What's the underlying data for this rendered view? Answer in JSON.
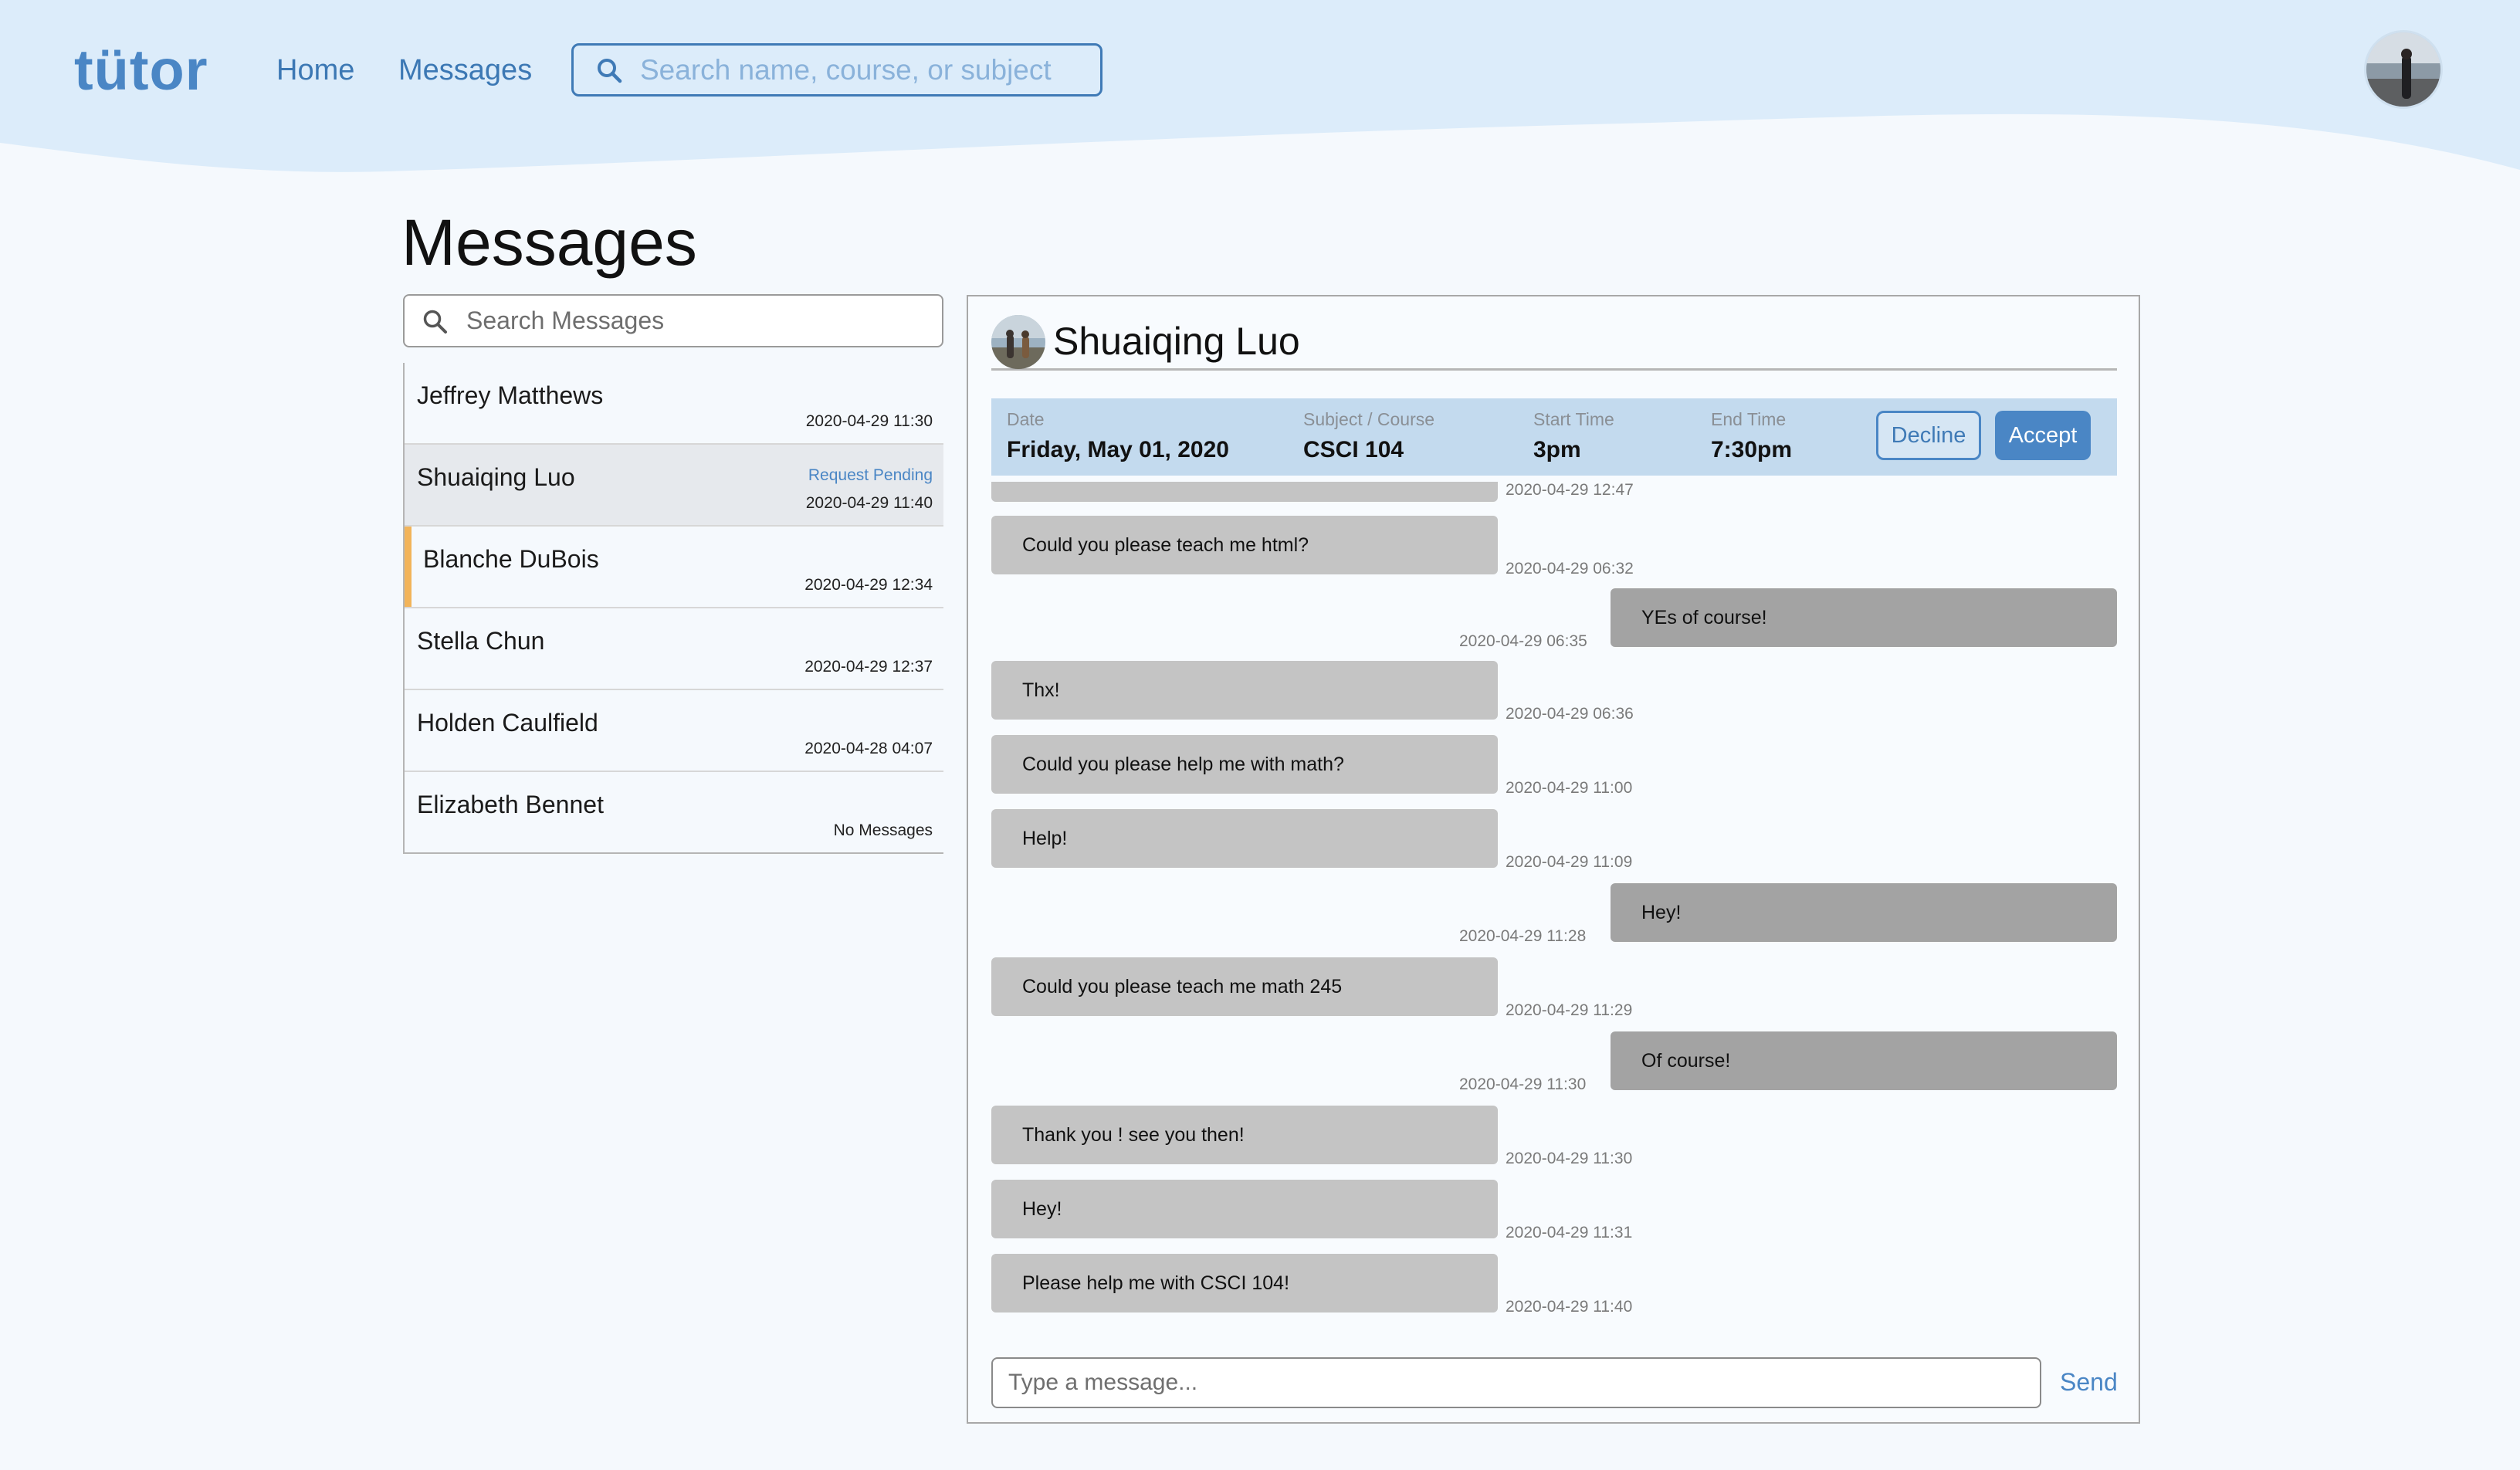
{
  "brand": {
    "logo_text": "tütor",
    "primary_color": "#4a86c5",
    "header_bg": "#dcecfa"
  },
  "nav": {
    "home": "Home",
    "messages": "Messages"
  },
  "global_search": {
    "placeholder": "Search name, course, or subject",
    "icon": "search-icon"
  },
  "page_title": "Messages",
  "message_search": {
    "placeholder": "Search Messages",
    "icon": "search-icon"
  },
  "conversations": [
    {
      "name": "Jeffrey Matthews",
      "time": "2020-04-29 11:30",
      "status": ""
    },
    {
      "name": "Shuaiqing Luo",
      "time": "2020-04-29 11:40",
      "status": "Request Pending"
    },
    {
      "name": "Blanche DuBois",
      "time": "2020-04-29 12:34",
      "status": ""
    },
    {
      "name": "Stella Chun",
      "time": "2020-04-29 12:37",
      "status": ""
    },
    {
      "name": "Holden Caulfield",
      "time": "2020-04-28 04:07",
      "status": ""
    },
    {
      "name": "Elizabeth Bennet",
      "time": "No Messages",
      "status": ""
    }
  ],
  "chat": {
    "name": "Shuaiqing Luo",
    "request": {
      "date_label": "Date",
      "date_value": "Friday, May 01, 2020",
      "subject_label": "Subject / Course",
      "subject_value": "CSCI 104",
      "start_label": "Start Time",
      "start_value": "3pm",
      "end_label": "End Time",
      "end_value": "7:30pm",
      "decline_label": "Decline",
      "accept_label": "Accept"
    },
    "messages": [
      {
        "dir": "in",
        "text": "",
        "time": "2020-04-29 12:47"
      },
      {
        "dir": "in",
        "text": "Could you please teach me html?",
        "time": "2020-04-29 06:32"
      },
      {
        "dir": "out",
        "text": "YEs of course!",
        "time": "2020-04-29 06:35"
      },
      {
        "dir": "in",
        "text": "Thx!",
        "time": "2020-04-29 06:36"
      },
      {
        "dir": "in",
        "text": "Could you please help me with math?",
        "time": "2020-04-29 11:00"
      },
      {
        "dir": "in",
        "text": "Help!",
        "time": "2020-04-29 11:09"
      },
      {
        "dir": "out",
        "text": "Hey!",
        "time": "2020-04-29 11:28"
      },
      {
        "dir": "in",
        "text": "Could you please teach me math 245",
        "time": "2020-04-29 11:29"
      },
      {
        "dir": "out",
        "text": "Of course!",
        "time": "2020-04-29 11:30"
      },
      {
        "dir": "in",
        "text": "Thank you ! see you then!",
        "time": "2020-04-29 11:30"
      },
      {
        "dir": "in",
        "text": "Hey!",
        "time": "2020-04-29 11:31"
      },
      {
        "dir": "in",
        "text": "Please help me with CSCI 104!",
        "time": "2020-04-29 11:40"
      }
    ],
    "composer_placeholder": "Type a message...",
    "send_label": "Send"
  }
}
